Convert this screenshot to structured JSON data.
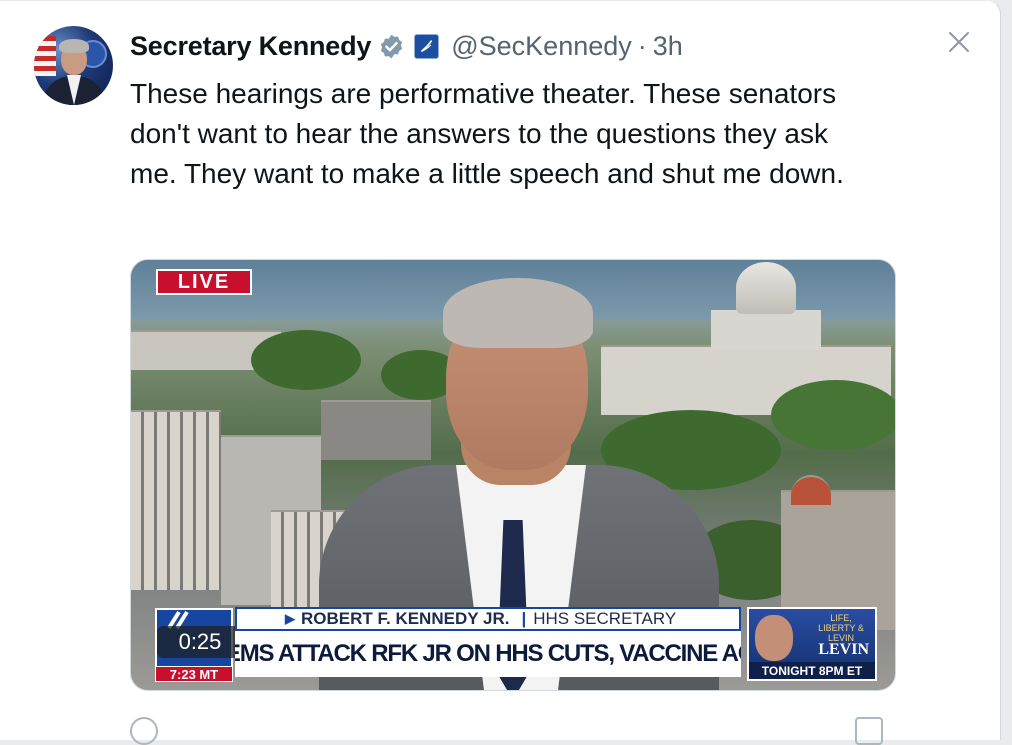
{
  "tweet": {
    "author_name": "Secretary Kennedy",
    "handle": "@SecKennedy",
    "separator": "·",
    "time": "3h",
    "text": "These hearings are performative theater. These senators don't want to hear the answers to the questions they ask me. They want to make a little speech and shut me down."
  },
  "icons": {
    "verified": "verified-badge-icon",
    "affiliation": "hhs-affiliation-icon",
    "close": "close-icon"
  },
  "media": {
    "live_label": "LIVE",
    "duration": "0:25",
    "chyron_name": "ROBERT F. KENNEDY JR.",
    "chyron_title": "HHS SECRETARY",
    "chyron_headline": "SEN DEMS ATTACK RFK JR ON HHS CUTS, VACCINE AGENDA",
    "clock": "7:23 MT",
    "promo_top": "LIFE, LIBERTY & LEVIN",
    "promo_name": "LEVIN",
    "promo_time": "TONIGHT 8PM ET"
  },
  "colors": {
    "text": "#0f1419",
    "secondary": "#536471",
    "live_red": "#c8102e",
    "fox_blue": "#1746a2"
  }
}
